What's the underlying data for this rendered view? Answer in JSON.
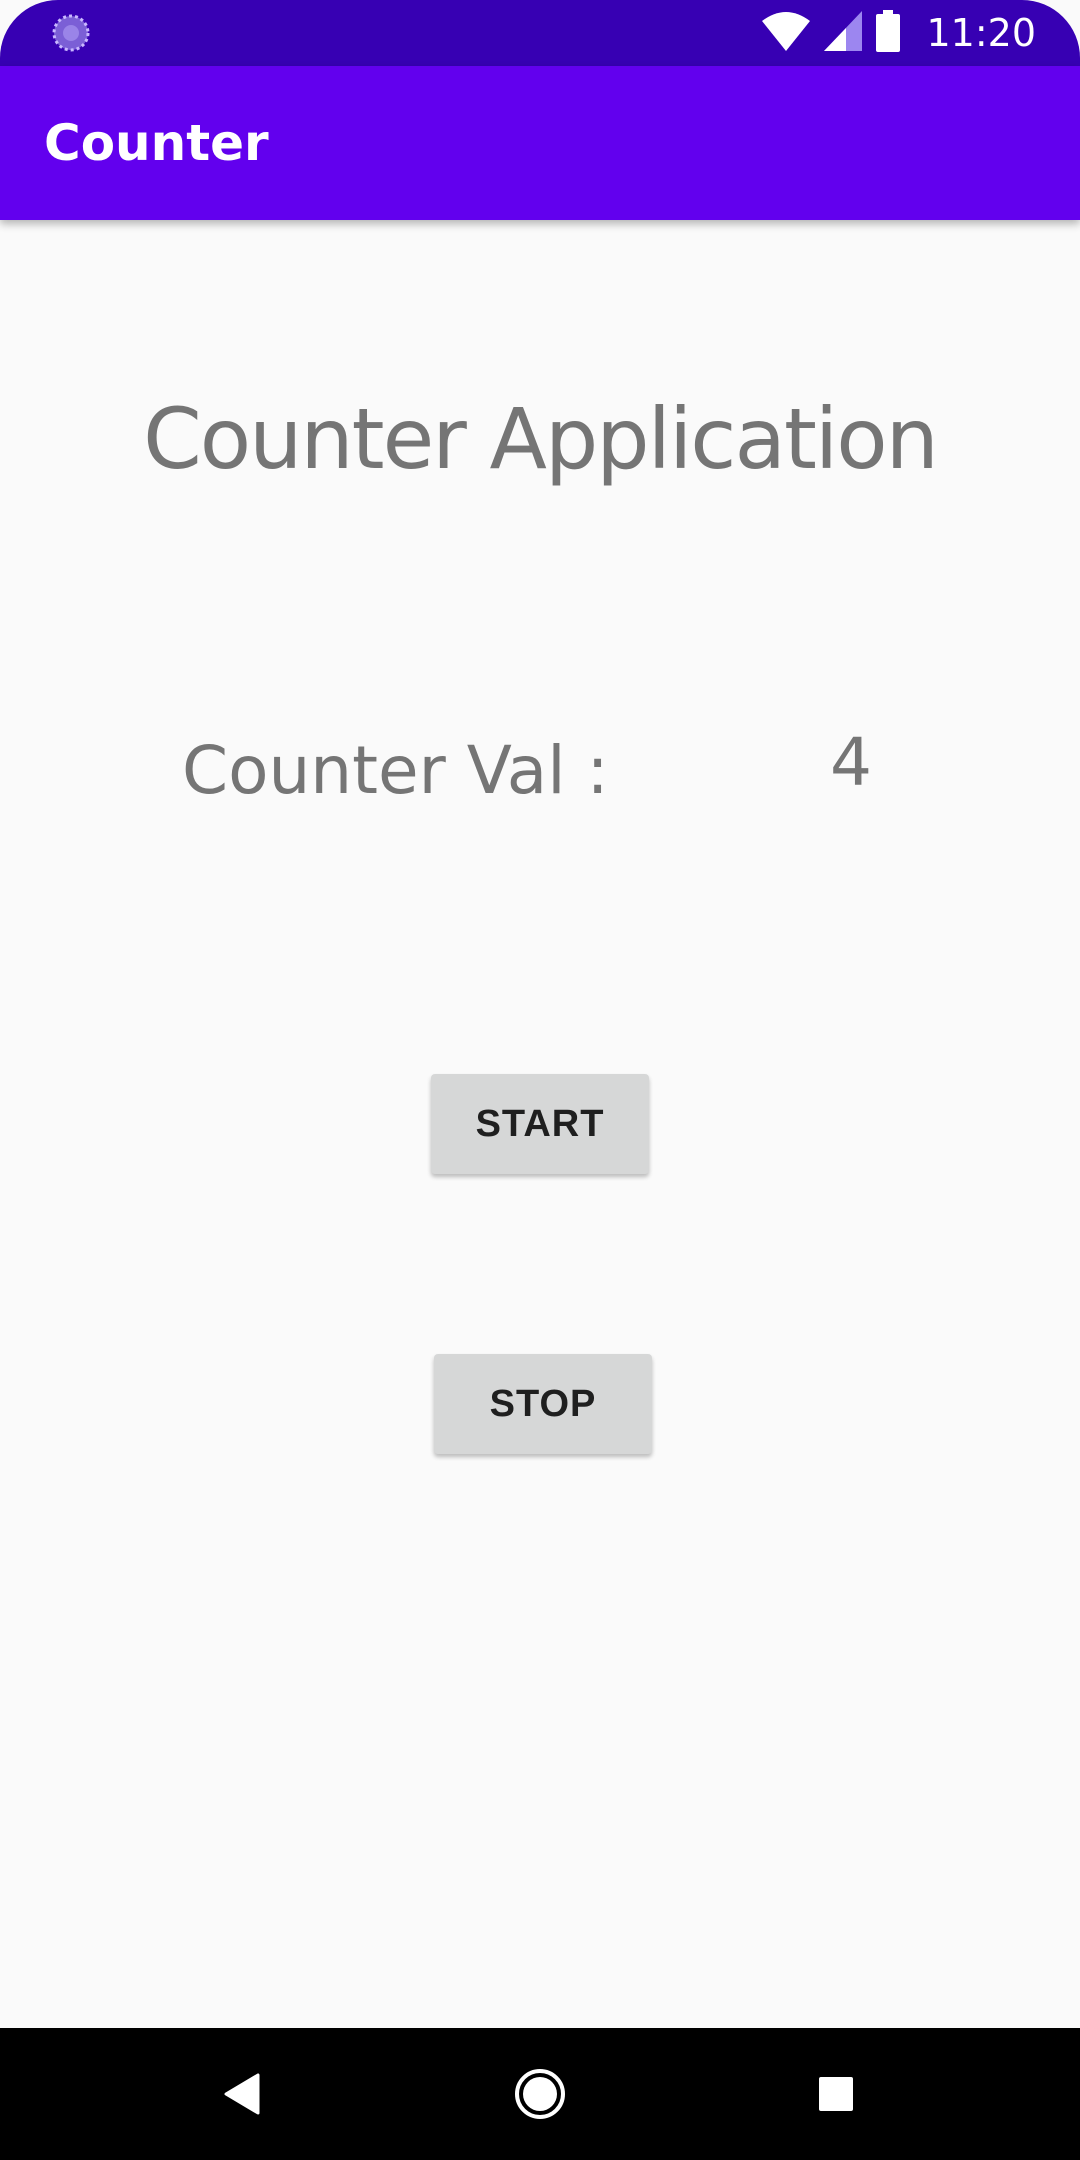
{
  "status_bar": {
    "time": "11:20",
    "left_icon": "notification-spinner-icon",
    "icons": [
      "wifi-icon",
      "signal-icon",
      "battery-icon"
    ],
    "color": "#3700b3"
  },
  "app_bar": {
    "title": "Counter",
    "color": "#6200ee"
  },
  "main": {
    "heading": "Counter Application",
    "counter_label": "Counter Val :",
    "counter_value": "4",
    "start_label": "START",
    "stop_label": "STOP",
    "text_color": "#757575",
    "button_color": "#d6d7d7"
  },
  "nav_bar": {
    "buttons": [
      "back-icon",
      "home-icon",
      "recents-icon"
    ]
  }
}
